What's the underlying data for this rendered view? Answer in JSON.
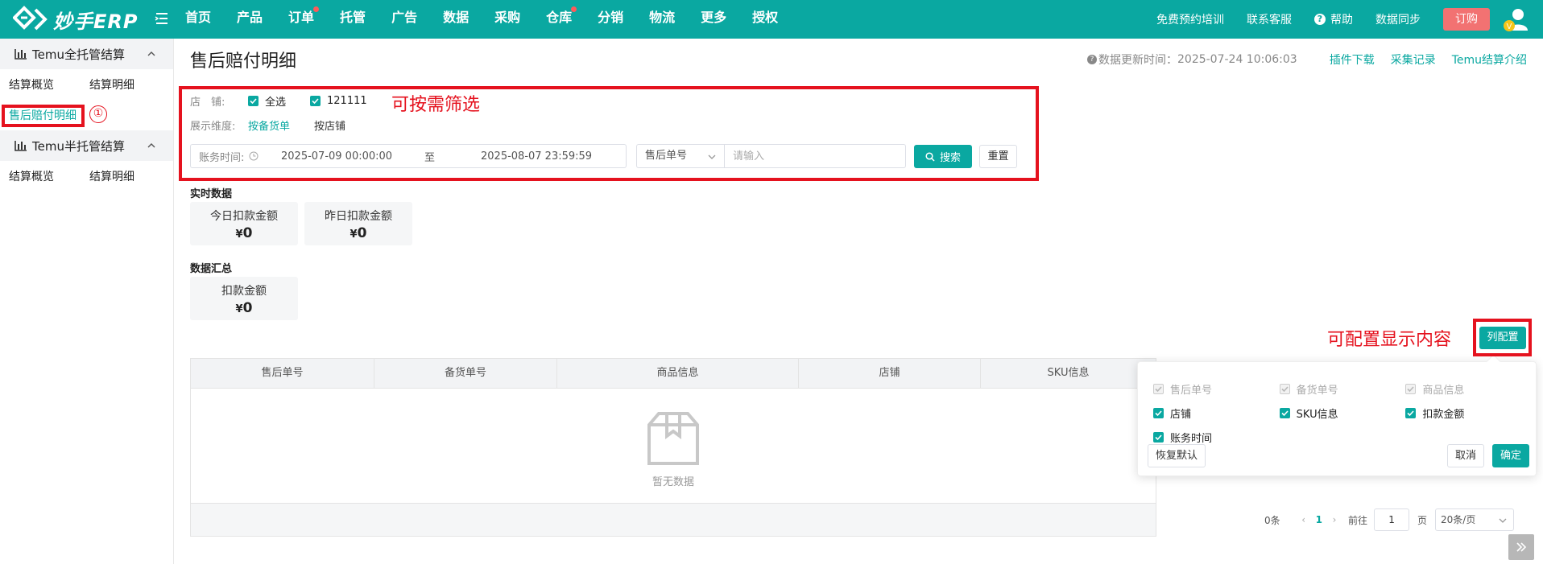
{
  "brand": {
    "name": "妙手ERP",
    "accent": "#0aa8a1"
  },
  "topnav": {
    "items": [
      {
        "label": "首页",
        "dot": false
      },
      {
        "label": "产品",
        "dot": false
      },
      {
        "label": "订单",
        "dot": true
      },
      {
        "label": "托管",
        "dot": false
      },
      {
        "label": "广告",
        "dot": false
      },
      {
        "label": "数据",
        "dot": false
      },
      {
        "label": "采购",
        "dot": false
      },
      {
        "label": "仓库",
        "dot": true
      },
      {
        "label": "分销",
        "dot": false
      },
      {
        "label": "物流",
        "dot": false
      },
      {
        "label": "更多",
        "dot": false
      },
      {
        "label": "授权",
        "dot": false
      }
    ],
    "right": {
      "training": "免费预约培训",
      "support": "联系客服",
      "help": "帮助",
      "sync": "数据同步",
      "order": "订购",
      "avatar_badge": "V"
    }
  },
  "sidebar": {
    "groups": [
      {
        "title": "Temu全托管结算",
        "items": [
          "结算概览",
          "结算明细",
          "售后赔付明细"
        ],
        "active": "售后赔付明细"
      },
      {
        "title": "Temu半托管结算",
        "items": [
          "结算概览",
          "结算明细"
        ]
      }
    ]
  },
  "page": {
    "title": "售后赔付明细",
    "update_label": "数据更新时间：",
    "update_time": "2025-07-24 10:06:03",
    "links": [
      "插件下载",
      "采集记录",
      "Temu结算介绍"
    ]
  },
  "filter": {
    "shop_label": "店　铺:",
    "shops": [
      {
        "label": "全选",
        "checked": true
      },
      {
        "label": "121111",
        "checked": true
      }
    ],
    "dimension_label": "展示维度:",
    "dimensions": [
      {
        "label": "按备货单",
        "active": true
      },
      {
        "label": "按店铺",
        "active": false
      }
    ],
    "date_label": "账务时间:",
    "date_start": "2025-07-09 00:00:00",
    "date_sep": "至",
    "date_end": "2025-08-07 23:59:59",
    "select_value": "售后单号",
    "input_placeholder": "请输入",
    "input_value": "",
    "search_btn": "搜索",
    "reset_btn": "重置"
  },
  "realtime": {
    "title": "实时数据",
    "cards": [
      {
        "label": "今日扣款金额",
        "currency": "¥",
        "value": "0"
      },
      {
        "label": "昨日扣款金额",
        "currency": "¥",
        "value": "0"
      }
    ]
  },
  "summary": {
    "title": "数据汇总",
    "cards": [
      {
        "label": "扣款金额",
        "currency": "¥",
        "value": "0"
      }
    ]
  },
  "table": {
    "columns": [
      "售后单号",
      "备货单号",
      "商品信息",
      "店铺",
      "SKU信息"
    ],
    "empty_text": "暂无数据"
  },
  "column_config": {
    "button": "列配置",
    "options": [
      {
        "label": "售后单号",
        "checked": true,
        "disabled": true
      },
      {
        "label": "备货单号",
        "checked": true,
        "disabled": true
      },
      {
        "label": "商品信息",
        "checked": true,
        "disabled": true
      },
      {
        "label": "店铺",
        "checked": true,
        "disabled": false
      },
      {
        "label": "SKU信息",
        "checked": true,
        "disabled": false
      },
      {
        "label": "扣款金额",
        "checked": true,
        "disabled": false
      },
      {
        "label": "账务时间",
        "checked": true,
        "disabled": false
      }
    ],
    "restore": "恢复默认",
    "cancel": "取消",
    "ok": "确定"
  },
  "pagination": {
    "total": "0条",
    "current": "1",
    "goto_label": "前往",
    "goto_value": "1",
    "page_suffix": "页",
    "page_size": "20条/页"
  },
  "annotations": {
    "filter_note": "可按需筛选",
    "column_note": "可配置显示内容",
    "step_marker": "①",
    "color": "#e5121e"
  }
}
